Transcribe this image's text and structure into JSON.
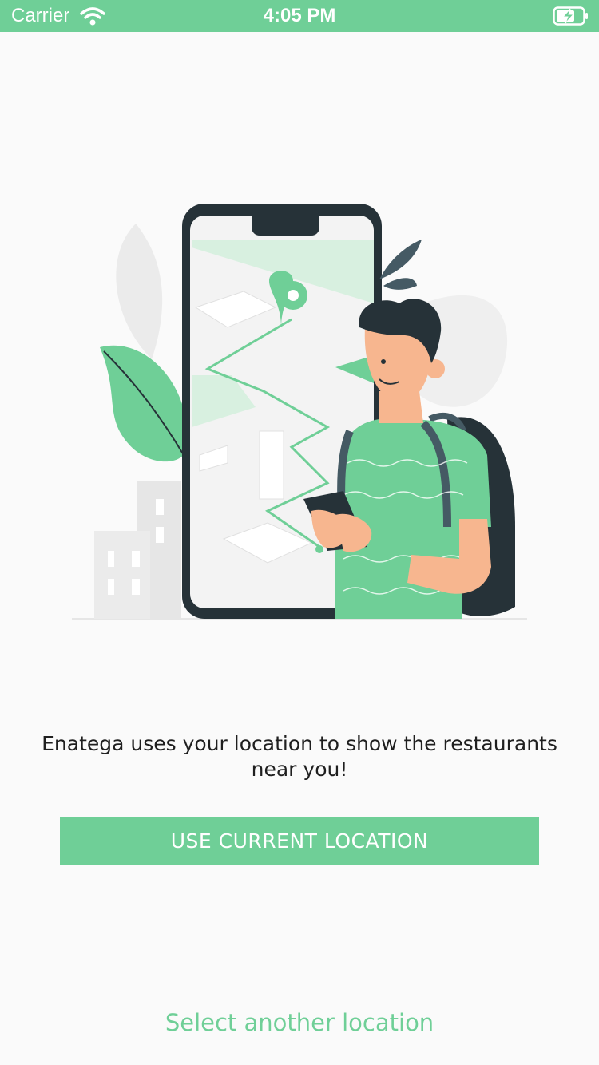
{
  "status_bar": {
    "carrier": "Carrier",
    "time": "4:05 PM",
    "wifi_icon": "wifi-icon",
    "battery_icon": "battery-charging-icon"
  },
  "illustration": {
    "description_icon": "location-map-illustration"
  },
  "main": {
    "message": "Enatega uses your location to show the restaurants near you!",
    "use_current_location_label": "USE CURRENT LOCATION",
    "select_another_location_label": "Select another location"
  },
  "colors": {
    "accent": "#6fcf97",
    "background": "#fafafa",
    "text": "#1f1f1f"
  }
}
